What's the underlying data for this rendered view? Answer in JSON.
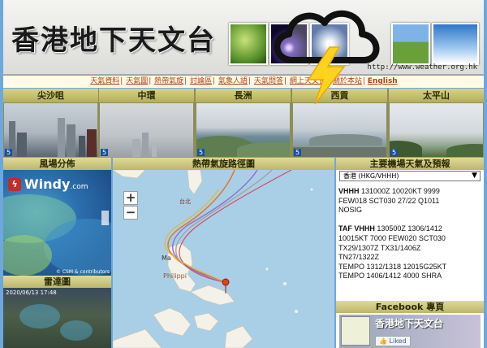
{
  "banner": {
    "title": "香港地下天文台",
    "url": "http://www.weather.org.hk"
  },
  "nav": {
    "items": [
      "天氣資料",
      "天氣圖",
      "熱帶氣旋",
      "討論區",
      "氣象人語",
      "天氣問答",
      "網上天文台",
      "關於本站"
    ],
    "separator": "|",
    "english": "English"
  },
  "webcams": [
    {
      "label": "尖沙咀",
      "num": "5"
    },
    {
      "label": "中環",
      "num": "5"
    },
    {
      "label": "長洲",
      "num": "5"
    },
    {
      "label": "西貢",
      "num": "5"
    },
    {
      "label": "太平山",
      "num": "5"
    }
  ],
  "left": {
    "wind_title": "風場分佈",
    "windy_brand": "Windy",
    "windy_suffix": ".com",
    "windy_credit": "© CSM & contributors",
    "radar_title": "雷達圖",
    "radar_time": "2020/06/13 17:48"
  },
  "center": {
    "title": "熱帶氣旋路徑圖",
    "zoom_in": "+",
    "zoom_out": "−",
    "labels": {
      "taipei": "台北",
      "manila": "Ma",
      "philippines": "Philippi"
    }
  },
  "right": {
    "title": "主要機場天氣及預報",
    "airport_option": "香港 (HKG/VHHH)",
    "metar_lines": [
      [
        "VHHH",
        " 131000Z 10020KT 9999"
      ],
      [
        "",
        "FEW018 SCT030 27/22 Q1011"
      ],
      [
        "",
        "NOSIG"
      ],
      [
        "",
        ""
      ],
      [
        "TAF VHHH",
        " 130500Z 1306/1412"
      ],
      [
        "",
        "10015KT 7000 FEW020 SCT030"
      ],
      [
        "",
        "TX29/1307Z TX31/1406Z"
      ],
      [
        "",
        "TN27/1322Z"
      ],
      [
        "",
        "TEMPO 1312/1318 12015G25KT"
      ],
      [
        "",
        "TEMPO 1406/1412 4000 SHRA"
      ]
    ],
    "fb_title": "Facebook 專頁",
    "fb_page_name": "香港地下天文台",
    "fb_like": "Liked"
  },
  "colors": {
    "page_bg": "#6ea7dd",
    "header_bar": "#bdb76a",
    "nav_link": "#b3421b",
    "track_colors": [
      "#e07b2a",
      "#8b6fd1",
      "#a3a3a3",
      "#d14e6b",
      "#e5b53b"
    ]
  },
  "icons": {
    "logo": "storm-cloud-lightning-icon"
  }
}
